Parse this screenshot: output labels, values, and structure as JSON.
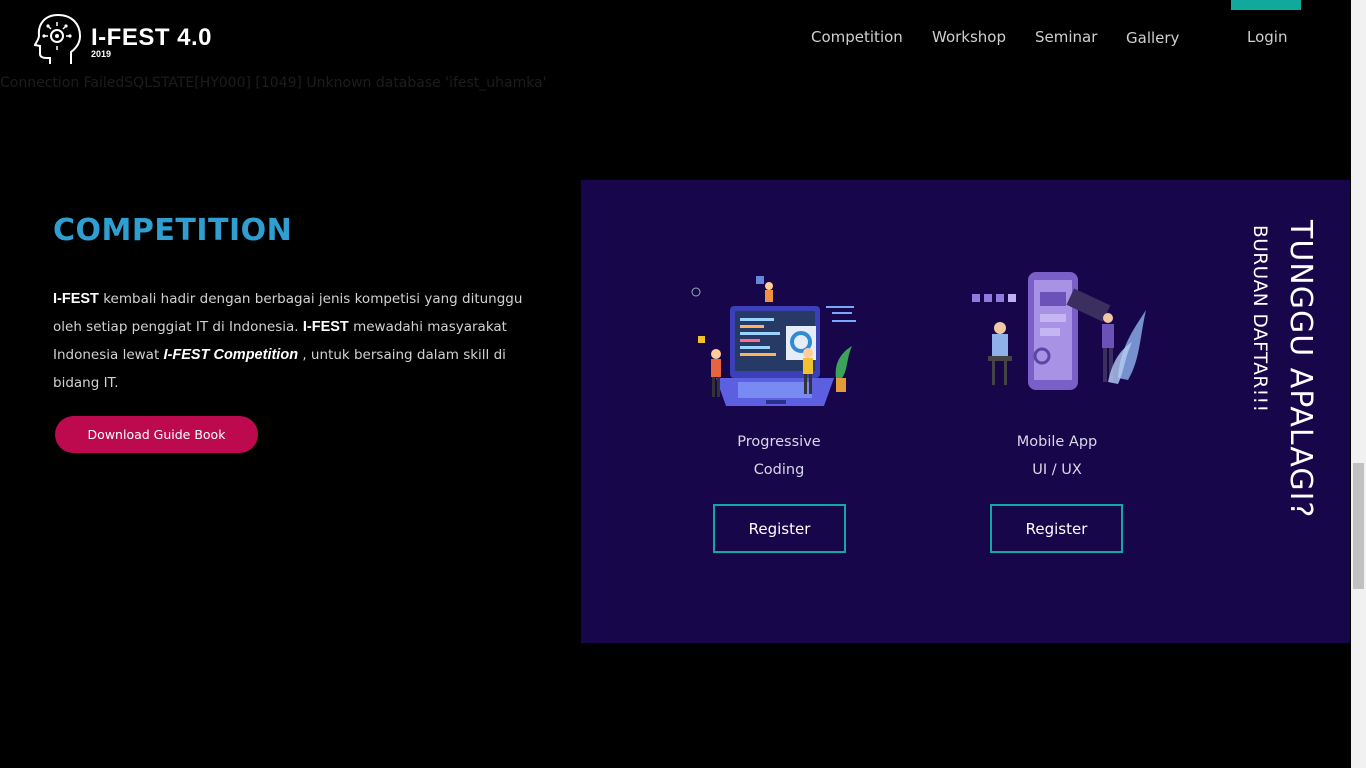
{
  "header": {
    "logo_title": "I-FEST 4.0",
    "logo_year": "2019",
    "nav": [
      {
        "label": "Competition"
      },
      {
        "label": "Workshop"
      },
      {
        "label": "Seminar"
      },
      {
        "label": "Gallery"
      },
      {
        "label": "Login"
      }
    ]
  },
  "error_message": "Connection FailedSQLSTATE[HY000] [1049] Unknown database 'ifest_uhamka'",
  "competition": {
    "title": "COMPETITION",
    "intro": {
      "brand": "I-FEST",
      "text_1": " kembali hadir dengan berbagai jenis kompetisi yang ditunggu oleh setiap penggiat IT di Indonesia. ",
      "text_2": " mewadahi masyarakat Indonesia lewat ",
      "brand_competition": "I-FEST Competition",
      "text_3": " , untuk bersaing dalam skill di bidang IT."
    },
    "download_label": "Download Guide Book"
  },
  "cards": [
    {
      "title_line_1": "Progressive",
      "title_line_2": "Coding",
      "button_label": "Register",
      "illustration_icon": "laptop-coding-illustration"
    },
    {
      "title_line_1": "Mobile App",
      "title_line_2": "UI / UX",
      "button_label": "Register",
      "illustration_icon": "mobile-app-illustration"
    }
  ],
  "promo": {
    "headline": "TUNGGU APALAGI?",
    "subline": "BURUAN DAFTAR!!!"
  },
  "colors": {
    "background": "#000000",
    "panel": "#17064a",
    "title_blue": "#2f9fd1",
    "button_pink": "#bd0a4f",
    "register_border": "#13a7a3",
    "accent_teal": "#11a99c"
  }
}
